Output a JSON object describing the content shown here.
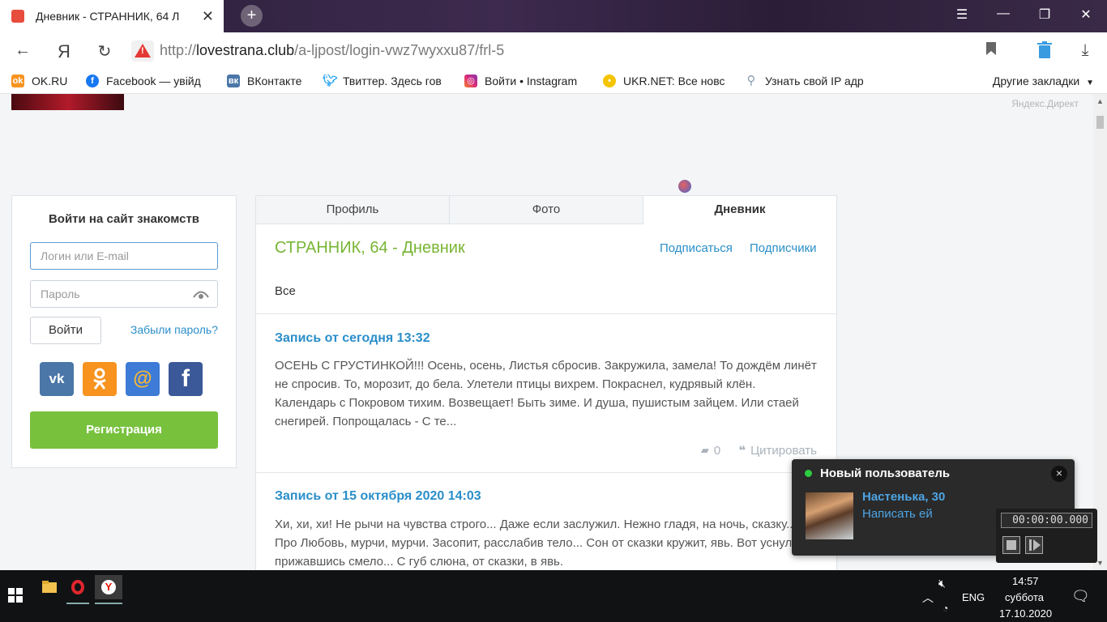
{
  "browser": {
    "tab_title": "Дневник - СТРАННИК, 64 Л",
    "new_tab": "+",
    "url_prefix": "http://",
    "url_domain": "lovestrana.club",
    "url_path": "/a-ljpost/login-vwz7wyxxu87/frl-5"
  },
  "bookmarks": {
    "items": [
      {
        "label": "OK.RU",
        "icon": "ok-icon",
        "color": "#f7931e"
      },
      {
        "label": "Facebook — увійд",
        "icon": "facebook-icon",
        "color": "#1877f2"
      },
      {
        "label": "ВКонтакте",
        "icon": "vk-icon",
        "color": "#4a76a8"
      },
      {
        "label": "Твиттер. Здесь гов",
        "icon": "twitter-icon",
        "color": "#1da1f2"
      },
      {
        "label": "Войти • Instagram",
        "icon": "instagram-icon",
        "color": "#c13584"
      },
      {
        "label": "UKR.NET: Все новс",
        "icon": "ukrnet-icon",
        "color": "#f5c400"
      },
      {
        "label": "Узнать свой IP адр",
        "icon": "search-icon",
        "color": "#8a9bb0"
      }
    ],
    "other": "Другие закладки"
  },
  "page": {
    "direct_label": "Яндекс.Директ"
  },
  "login": {
    "title": "Войти на сайт знакомств",
    "login_placeholder": "Логин или E-mail",
    "password_placeholder": "Пароль",
    "submit": "Войти",
    "forgot": "Забыли пароль?",
    "register": "Регистрация",
    "social": [
      {
        "name": "vk-login-button",
        "glyph": "vk",
        "color": "#4a76a8"
      },
      {
        "name": "ok-login-button",
        "glyph": "ок",
        "color": "#f7931e"
      },
      {
        "name": "mailru-login-button",
        "glyph": "@",
        "color": "#3d7bd6"
      },
      {
        "name": "facebook-login-button",
        "glyph": "f",
        "color": "#3b5998"
      }
    ]
  },
  "diary": {
    "tabs": [
      "Профиль",
      "Фото",
      "Дневник"
    ],
    "active_tab": 2,
    "title": "СТРАННИК, 64 - Дневник",
    "subscribe": "Подписаться",
    "subscribers": "Подписчики",
    "filter": "Все",
    "entries": [
      {
        "title": "Запись от сегодня 13:32",
        "text": "ОСЕНЬ С ГРУСТИНКОЙ!!! Осень, осень, Листья сбросив. Закружила, замела! То дождём линёт не спросив. То, морозит, до бела. Улетели птицы вихрем. Покраснел, кудрявый клён. Календарь с Покровом тихим. Возвещает! Быть зиме. И душа, пушистым зайцем. Или стаей снегирей. Попрощалась - С те...",
        "comments": "0",
        "quote": "Цитировать"
      },
      {
        "title": "Запись от 15 октября 2020 14:03",
        "text": "Хи, хи, хи! Не рычи на чувства строго... Даже если заслужил. Нежно гладя, на ночь, сказку... Про Любовь, мурчи, мурчи. Засопит, расслабив тело... Сон от сказки кружит, явь. Вот уснул, прижавшись смело... С губ слюна, от сказки, в явь."
      }
    ]
  },
  "notification": {
    "heading": "Новый пользователь",
    "name": "Настенька, 30",
    "action": "Написать ей",
    "close": "×"
  },
  "recorder": {
    "time": "00:00:00.000"
  },
  "taskbar": {
    "lang": "ENG",
    "time": "14:57",
    "day": "суббота",
    "date": "17.10.2020"
  }
}
